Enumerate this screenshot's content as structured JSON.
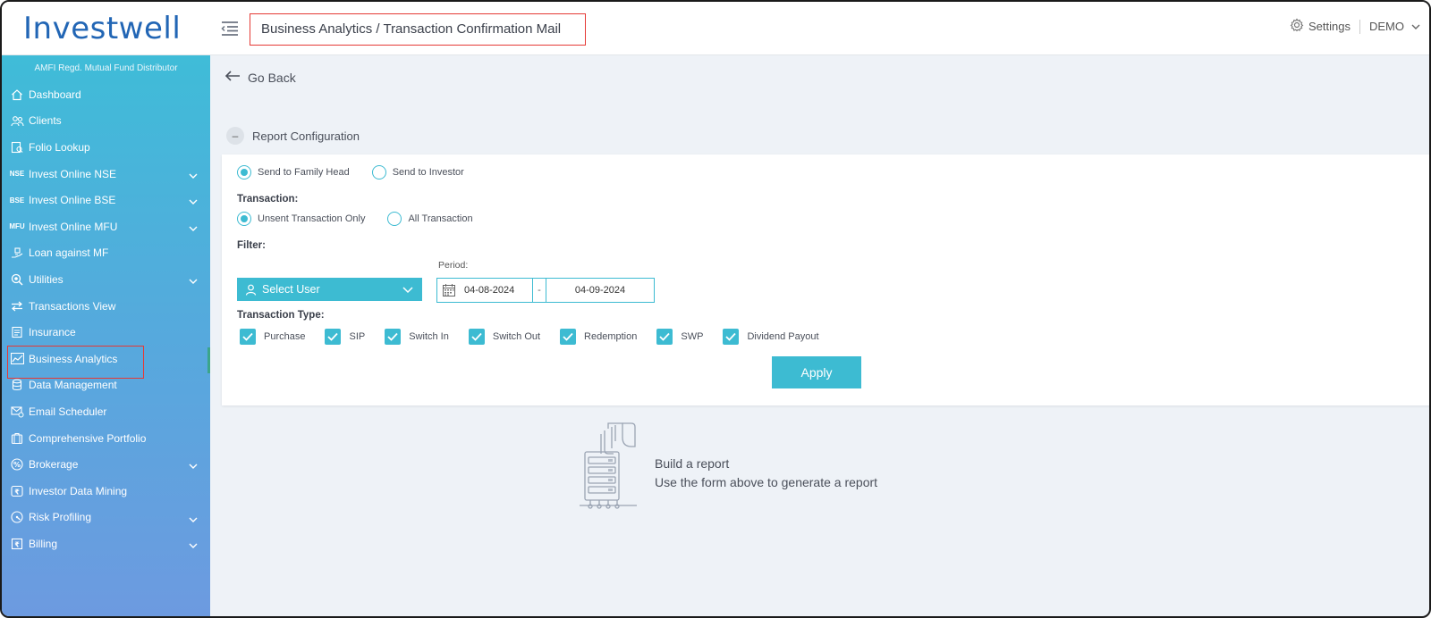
{
  "app": {
    "logo": "Investwell",
    "breadcrumb": "Business Analytics / Transaction Confirmation Mail",
    "settings_label": "Settings",
    "user_label": "DEMO"
  },
  "sidebar": {
    "tagline": "AMFI Regd. Mutual Fund Distributor",
    "items": [
      {
        "label": "Dashboard",
        "icon": "home-icon",
        "has_chevron": false
      },
      {
        "label": "Clients",
        "icon": "users-icon",
        "has_chevron": false
      },
      {
        "label": "Folio Lookup",
        "icon": "folio-icon",
        "has_chevron": false
      },
      {
        "label": "Invest Online NSE",
        "icon": "nse-icon",
        "icon_text": "NSE",
        "has_chevron": true
      },
      {
        "label": "Invest Online BSE",
        "icon": "bse-icon",
        "icon_text": "BSE",
        "has_chevron": true
      },
      {
        "label": "Invest Online MFU",
        "icon": "mfu-icon",
        "icon_text": "MFU",
        "has_chevron": true
      },
      {
        "label": "Loan against MF",
        "icon": "loan-icon",
        "has_chevron": false
      },
      {
        "label": "Utilities",
        "icon": "utilities-icon",
        "has_chevron": true
      },
      {
        "label": "Transactions View",
        "icon": "transfer-icon",
        "has_chevron": false
      },
      {
        "label": "Insurance",
        "icon": "insurance-icon",
        "has_chevron": false
      },
      {
        "label": "Business Analytics",
        "icon": "chart-icon",
        "has_chevron": false
      },
      {
        "label": "Data Management",
        "icon": "database-icon",
        "has_chevron": false
      },
      {
        "label": "Email Scheduler",
        "icon": "email-icon",
        "has_chevron": false
      },
      {
        "label": "Comprehensive Portfolio",
        "icon": "portfolio-icon",
        "has_chevron": false
      },
      {
        "label": "Brokerage",
        "icon": "percent-icon",
        "has_chevron": true
      },
      {
        "label": "Investor Data Mining",
        "icon": "rupee-icon",
        "has_chevron": false
      },
      {
        "label": "Risk Profiling",
        "icon": "gauge-icon",
        "has_chevron": true
      },
      {
        "label": "Billing",
        "icon": "billing-icon",
        "has_chevron": true
      }
    ]
  },
  "main": {
    "go_back": "Go Back",
    "report_config": "Report Configuration",
    "send_options": [
      {
        "label": "Send to Family Head",
        "selected": true
      },
      {
        "label": "Send to Investor",
        "selected": false
      }
    ],
    "transaction_label": "Transaction:",
    "transaction_options": [
      {
        "label": "Unsent Transaction Only",
        "selected": true
      },
      {
        "label": "All Transaction",
        "selected": false
      }
    ],
    "filter_label": "Filter:",
    "period_label": "Period:",
    "select_user": "Select User",
    "date_from": "04-08-2024",
    "date_sep": "-",
    "date_to": "04-09-2024",
    "transaction_type_label": "Transaction Type:",
    "transaction_types": [
      {
        "label": "Purchase",
        "checked": true
      },
      {
        "label": "SIP",
        "checked": true
      },
      {
        "label": "Switch In",
        "checked": true
      },
      {
        "label": "Switch Out",
        "checked": true
      },
      {
        "label": "Redemption",
        "checked": true
      },
      {
        "label": "SWP",
        "checked": true
      },
      {
        "label": "Dividend Payout",
        "checked": true
      }
    ],
    "apply": "Apply",
    "empty_title": "Build a report",
    "empty_sub": "Use the form above to generate a report"
  },
  "colors": {
    "accent": "#3dbbd2",
    "brand": "#2266b5",
    "highlight_box": "#e53935"
  }
}
